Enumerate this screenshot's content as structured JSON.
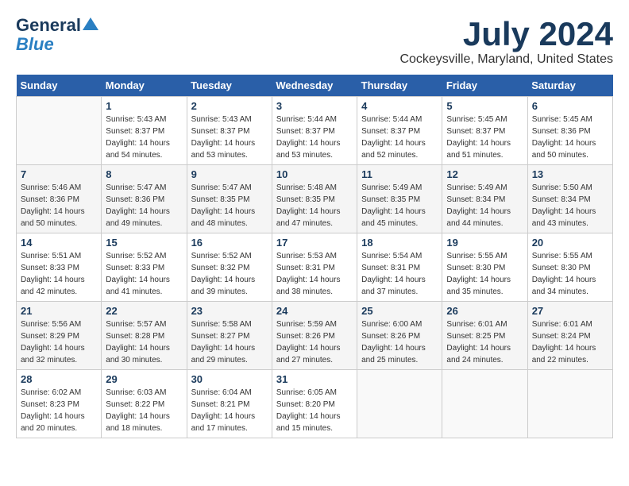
{
  "header": {
    "logo_line1": "General",
    "logo_line2": "Blue",
    "month_title": "July 2024",
    "location": "Cockeysville, Maryland, United States"
  },
  "days_of_week": [
    "Sunday",
    "Monday",
    "Tuesday",
    "Wednesday",
    "Thursday",
    "Friday",
    "Saturday"
  ],
  "weeks": [
    [
      {
        "day": "",
        "sunrise": "",
        "sunset": "",
        "daylight": ""
      },
      {
        "day": "1",
        "sunrise": "Sunrise: 5:43 AM",
        "sunset": "Sunset: 8:37 PM",
        "daylight": "Daylight: 14 hours and 54 minutes."
      },
      {
        "day": "2",
        "sunrise": "Sunrise: 5:43 AM",
        "sunset": "Sunset: 8:37 PM",
        "daylight": "Daylight: 14 hours and 53 minutes."
      },
      {
        "day": "3",
        "sunrise": "Sunrise: 5:44 AM",
        "sunset": "Sunset: 8:37 PM",
        "daylight": "Daylight: 14 hours and 53 minutes."
      },
      {
        "day": "4",
        "sunrise": "Sunrise: 5:44 AM",
        "sunset": "Sunset: 8:37 PM",
        "daylight": "Daylight: 14 hours and 52 minutes."
      },
      {
        "day": "5",
        "sunrise": "Sunrise: 5:45 AM",
        "sunset": "Sunset: 8:37 PM",
        "daylight": "Daylight: 14 hours and 51 minutes."
      },
      {
        "day": "6",
        "sunrise": "Sunrise: 5:45 AM",
        "sunset": "Sunset: 8:36 PM",
        "daylight": "Daylight: 14 hours and 50 minutes."
      }
    ],
    [
      {
        "day": "7",
        "sunrise": "Sunrise: 5:46 AM",
        "sunset": "Sunset: 8:36 PM",
        "daylight": "Daylight: 14 hours and 50 minutes."
      },
      {
        "day": "8",
        "sunrise": "Sunrise: 5:47 AM",
        "sunset": "Sunset: 8:36 PM",
        "daylight": "Daylight: 14 hours and 49 minutes."
      },
      {
        "day": "9",
        "sunrise": "Sunrise: 5:47 AM",
        "sunset": "Sunset: 8:35 PM",
        "daylight": "Daylight: 14 hours and 48 minutes."
      },
      {
        "day": "10",
        "sunrise": "Sunrise: 5:48 AM",
        "sunset": "Sunset: 8:35 PM",
        "daylight": "Daylight: 14 hours and 47 minutes."
      },
      {
        "day": "11",
        "sunrise": "Sunrise: 5:49 AM",
        "sunset": "Sunset: 8:35 PM",
        "daylight": "Daylight: 14 hours and 45 minutes."
      },
      {
        "day": "12",
        "sunrise": "Sunrise: 5:49 AM",
        "sunset": "Sunset: 8:34 PM",
        "daylight": "Daylight: 14 hours and 44 minutes."
      },
      {
        "day": "13",
        "sunrise": "Sunrise: 5:50 AM",
        "sunset": "Sunset: 8:34 PM",
        "daylight": "Daylight: 14 hours and 43 minutes."
      }
    ],
    [
      {
        "day": "14",
        "sunrise": "Sunrise: 5:51 AM",
        "sunset": "Sunset: 8:33 PM",
        "daylight": "Daylight: 14 hours and 42 minutes."
      },
      {
        "day": "15",
        "sunrise": "Sunrise: 5:52 AM",
        "sunset": "Sunset: 8:33 PM",
        "daylight": "Daylight: 14 hours and 41 minutes."
      },
      {
        "day": "16",
        "sunrise": "Sunrise: 5:52 AM",
        "sunset": "Sunset: 8:32 PM",
        "daylight": "Daylight: 14 hours and 39 minutes."
      },
      {
        "day": "17",
        "sunrise": "Sunrise: 5:53 AM",
        "sunset": "Sunset: 8:31 PM",
        "daylight": "Daylight: 14 hours and 38 minutes."
      },
      {
        "day": "18",
        "sunrise": "Sunrise: 5:54 AM",
        "sunset": "Sunset: 8:31 PM",
        "daylight": "Daylight: 14 hours and 37 minutes."
      },
      {
        "day": "19",
        "sunrise": "Sunrise: 5:55 AM",
        "sunset": "Sunset: 8:30 PM",
        "daylight": "Daylight: 14 hours and 35 minutes."
      },
      {
        "day": "20",
        "sunrise": "Sunrise: 5:55 AM",
        "sunset": "Sunset: 8:30 PM",
        "daylight": "Daylight: 14 hours and 34 minutes."
      }
    ],
    [
      {
        "day": "21",
        "sunrise": "Sunrise: 5:56 AM",
        "sunset": "Sunset: 8:29 PM",
        "daylight": "Daylight: 14 hours and 32 minutes."
      },
      {
        "day": "22",
        "sunrise": "Sunrise: 5:57 AM",
        "sunset": "Sunset: 8:28 PM",
        "daylight": "Daylight: 14 hours and 30 minutes."
      },
      {
        "day": "23",
        "sunrise": "Sunrise: 5:58 AM",
        "sunset": "Sunset: 8:27 PM",
        "daylight": "Daylight: 14 hours and 29 minutes."
      },
      {
        "day": "24",
        "sunrise": "Sunrise: 5:59 AM",
        "sunset": "Sunset: 8:26 PM",
        "daylight": "Daylight: 14 hours and 27 minutes."
      },
      {
        "day": "25",
        "sunrise": "Sunrise: 6:00 AM",
        "sunset": "Sunset: 8:26 PM",
        "daylight": "Daylight: 14 hours and 25 minutes."
      },
      {
        "day": "26",
        "sunrise": "Sunrise: 6:01 AM",
        "sunset": "Sunset: 8:25 PM",
        "daylight": "Daylight: 14 hours and 24 minutes."
      },
      {
        "day": "27",
        "sunrise": "Sunrise: 6:01 AM",
        "sunset": "Sunset: 8:24 PM",
        "daylight": "Daylight: 14 hours and 22 minutes."
      }
    ],
    [
      {
        "day": "28",
        "sunrise": "Sunrise: 6:02 AM",
        "sunset": "Sunset: 8:23 PM",
        "daylight": "Daylight: 14 hours and 20 minutes."
      },
      {
        "day": "29",
        "sunrise": "Sunrise: 6:03 AM",
        "sunset": "Sunset: 8:22 PM",
        "daylight": "Daylight: 14 hours and 18 minutes."
      },
      {
        "day": "30",
        "sunrise": "Sunrise: 6:04 AM",
        "sunset": "Sunset: 8:21 PM",
        "daylight": "Daylight: 14 hours and 17 minutes."
      },
      {
        "day": "31",
        "sunrise": "Sunrise: 6:05 AM",
        "sunset": "Sunset: 8:20 PM",
        "daylight": "Daylight: 14 hours and 15 minutes."
      },
      {
        "day": "",
        "sunrise": "",
        "sunset": "",
        "daylight": ""
      },
      {
        "day": "",
        "sunrise": "",
        "sunset": "",
        "daylight": ""
      },
      {
        "day": "",
        "sunrise": "",
        "sunset": "",
        "daylight": ""
      }
    ]
  ]
}
